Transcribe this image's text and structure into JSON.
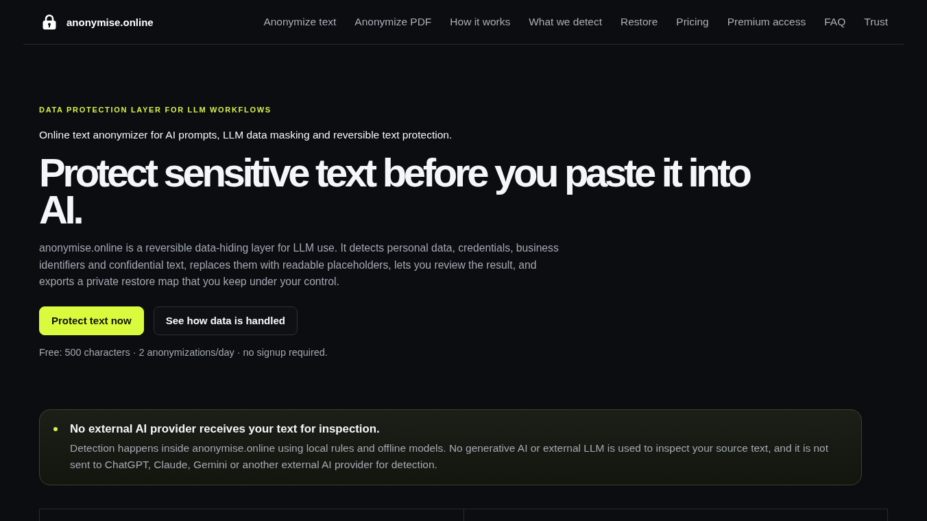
{
  "header": {
    "brand": "anonymise.online",
    "nav": [
      "Anonymize text",
      "Anonymize PDF",
      "How it works",
      "What we detect",
      "Restore",
      "Pricing",
      "Premium access",
      "FAQ",
      "Trust"
    ]
  },
  "hero": {
    "eyebrow": "DATA PROTECTION LAYER FOR LLM WORKFLOWS",
    "subtitle": "Online text anonymizer for AI prompts, LLM data masking and reversible text protection.",
    "title": "Protect sensitive text before you paste it into AI.",
    "description": "anonymise.online is a reversible data-hiding layer for LLM use. It detects personal data, credentials, business identifiers and confidential text, replaces them with readable placeholders, lets you review the result, and exports a private restore map that you keep under your control.",
    "buttons": [
      {
        "label": "Protect text now",
        "kind": "primary"
      },
      {
        "label": "See how data is handled",
        "kind": "secondary"
      }
    ],
    "note": "Free: 500 characters · 2 anonymizations/day · no signup required."
  },
  "notice": {
    "title": "No external AI provider receives your text for inspection.",
    "text": "Detection happens inside anonymise.online using local rules and offline models. No generative AI or external LLM is used to inspect your source text, and it is not sent to ChatGPT, Claude, Gemini or another external AI provider for detection."
  }
}
